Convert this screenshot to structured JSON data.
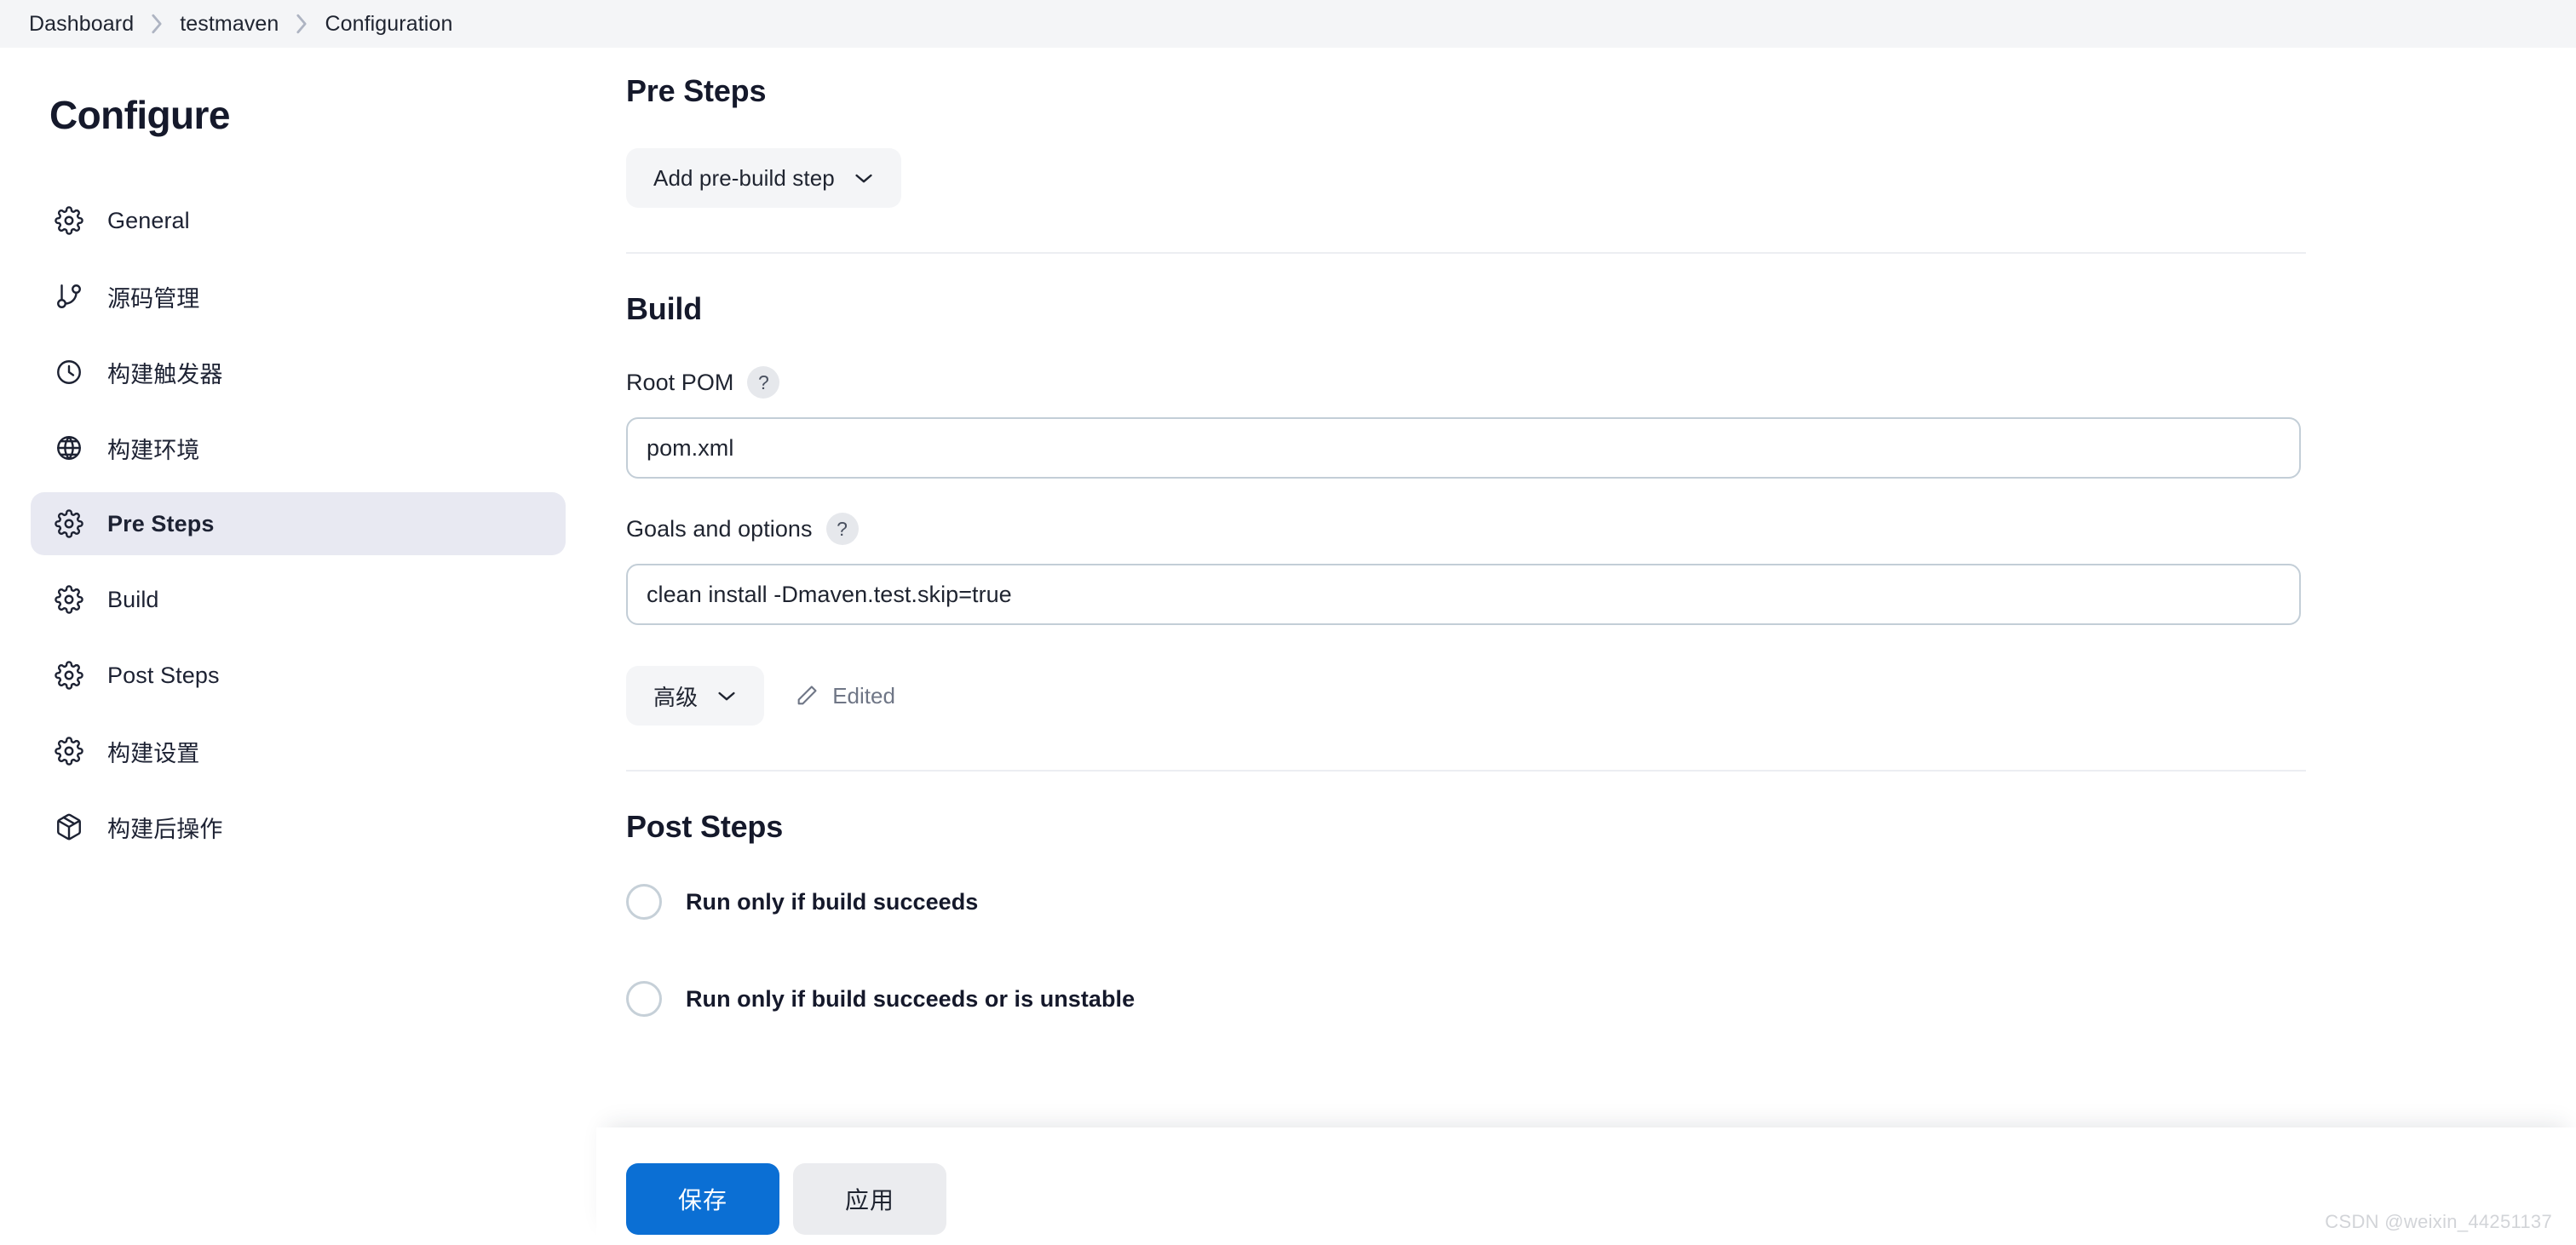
{
  "breadcrumb": {
    "items": [
      {
        "label": "Dashboard"
      },
      {
        "label": "testmaven"
      },
      {
        "label": "Configuration"
      }
    ],
    "separator_icon": "chevron-right-icon"
  },
  "sidebar": {
    "title": "Configure",
    "items": [
      {
        "label": "General",
        "icon": "gear-icon",
        "active": false
      },
      {
        "label": "源码管理",
        "icon": "git-branch-icon",
        "active": false
      },
      {
        "label": "构建触发器",
        "icon": "clock-icon",
        "active": false
      },
      {
        "label": "构建环境",
        "icon": "globe-icon",
        "active": false
      },
      {
        "label": "Pre Steps",
        "icon": "gear-icon",
        "active": true
      },
      {
        "label": "Build",
        "icon": "gear-icon",
        "active": false
      },
      {
        "label": "Post Steps",
        "icon": "gear-icon",
        "active": false
      },
      {
        "label": "构建设置",
        "icon": "gear-icon",
        "active": false
      },
      {
        "label": "构建后操作",
        "icon": "package-icon",
        "active": false
      }
    ]
  },
  "main": {
    "pre_steps": {
      "heading": "Pre Steps",
      "add_step_button": "Add pre-build step",
      "add_step_icon": "chevron-down-icon"
    },
    "build": {
      "heading": "Build",
      "root_pom": {
        "label": "Root POM",
        "help_icon": "question-mark-icon",
        "help_label": "?",
        "value": "pom.xml",
        "placeholder": ""
      },
      "goals": {
        "label": "Goals and options",
        "help_icon": "question-mark-icon",
        "help_label": "?",
        "value": "clean install -Dmaven.test.skip=true",
        "placeholder": ""
      },
      "advanced_button": "高级",
      "advanced_icon": "chevron-down-icon",
      "edited_label": "Edited",
      "edited_icon": "pencil-icon"
    },
    "post_steps": {
      "heading": "Post Steps",
      "options": [
        {
          "label": "Run only if build succeeds",
          "selected": false
        },
        {
          "label": "Run only if build succeeds or is unstable",
          "selected": false
        }
      ]
    }
  },
  "footer": {
    "save_label": "保存",
    "apply_label": "应用"
  },
  "watermark": "CSDN @weixin_44251137",
  "colors": {
    "accent": "#0b6fd4",
    "topbar_bg": "#f4f5f7",
    "active_nav_bg": "#e8e9f2",
    "input_border": "#c3ced7",
    "divider": "#eceef2",
    "muted_text": "#6f7686"
  }
}
